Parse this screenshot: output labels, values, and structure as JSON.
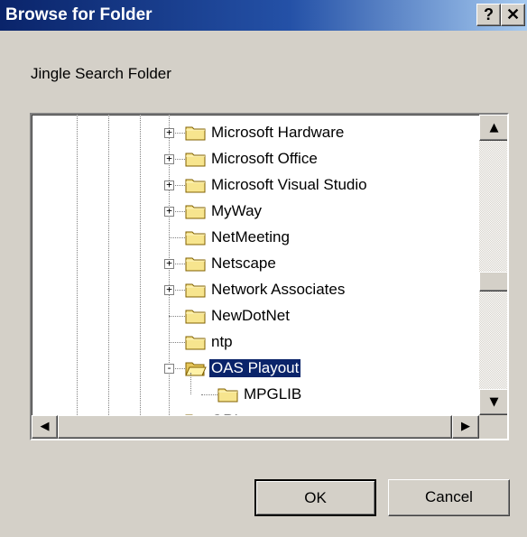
{
  "window": {
    "title": "Browse for Folder",
    "help_label": "?",
    "close_label": "✕"
  },
  "prompt": "Jingle Search Folder",
  "tree": {
    "items": [
      {
        "label": "Microsoft Hardware",
        "expander": "+",
        "selected": false
      },
      {
        "label": "Microsoft Office",
        "expander": "+",
        "selected": false
      },
      {
        "label": "Microsoft Visual Studio",
        "expander": "+",
        "selected": false
      },
      {
        "label": "MyWay",
        "expander": "+",
        "selected": false
      },
      {
        "label": "NetMeeting",
        "expander": "",
        "selected": false
      },
      {
        "label": "Netscape",
        "expander": "+",
        "selected": false
      },
      {
        "label": "Network Associates",
        "expander": "+",
        "selected": false
      },
      {
        "label": "NewDotNet",
        "expander": "",
        "selected": false
      },
      {
        "label": "ntp",
        "expander": "",
        "selected": false
      },
      {
        "label": "OAS Playout",
        "expander": "−",
        "selected": true
      },
      {
        "label": "MPGLIB",
        "expander": "",
        "selected": false
      },
      {
        "label": "ORL",
        "expander": "+",
        "selected": false
      }
    ]
  },
  "buttons": {
    "ok": "OK",
    "cancel": "Cancel"
  },
  "icons": {
    "up": "scroll-up-arrow-icon",
    "down": "scroll-down-arrow-icon",
    "left": "scroll-left-arrow-icon",
    "right": "scroll-right-arrow-icon",
    "folder": "folder-icon"
  },
  "colors": {
    "titlebar": "#0a246a",
    "selection": "#0a246a",
    "face": "#d4d0c8"
  }
}
